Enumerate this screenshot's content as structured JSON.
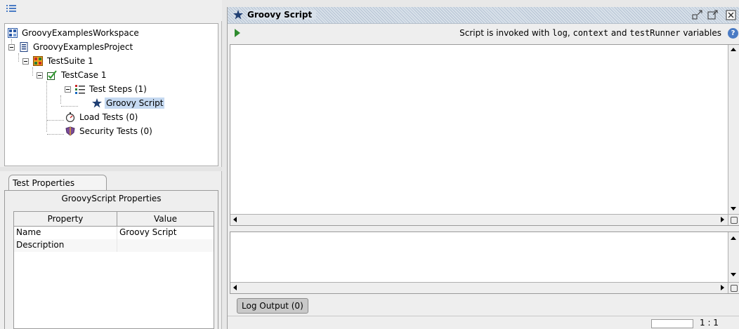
{
  "navigator": {
    "tree": [
      {
        "label": "GroovyExamplesWorkspace",
        "icon": "workspace-icon"
      },
      {
        "label": "GroovyExamplesProject",
        "icon": "project-icon"
      },
      {
        "label": "TestSuite 1",
        "icon": "testsuite-icon"
      },
      {
        "label": "TestCase 1",
        "icon": "testcase-icon"
      },
      {
        "label": "Test Steps (1)",
        "icon": "teststeps-icon"
      },
      {
        "label": "Groovy Script",
        "icon": "groovy-star-icon",
        "selected": true
      },
      {
        "label": "Load Tests (0)",
        "icon": "loadtest-icon"
      },
      {
        "label": "Security Tests (0)",
        "icon": "security-icon"
      }
    ]
  },
  "properties": {
    "tab_label": "Test Properties",
    "panel_title": "GroovyScript Properties",
    "columns": [
      "Property",
      "Value"
    ],
    "rows": [
      [
        "Name",
        "Groovy Script"
      ],
      [
        "Description",
        ""
      ]
    ]
  },
  "editor": {
    "title": "Groovy Script",
    "info_prefix": "Script is invoked with ",
    "info_var1": "log",
    "info_sep": ", ",
    "info_var2": "context",
    "info_and": " and ",
    "info_var3": "testRunner",
    "info_suffix": " variables",
    "log_tab": "Log Output (0)",
    "cursor_position": "1 : 1"
  },
  "colors": {
    "selection": "#c5d9f1",
    "run_green": "#2e8b2e",
    "groovy_star": "#1f3f73"
  }
}
